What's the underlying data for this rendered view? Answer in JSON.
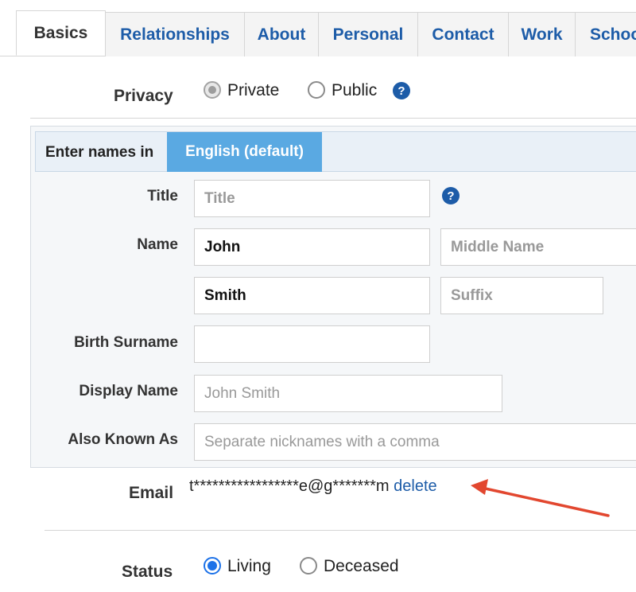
{
  "tabs": [
    {
      "label": "Basics",
      "active": true
    },
    {
      "label": "Relationships"
    },
    {
      "label": "About"
    },
    {
      "label": "Personal"
    },
    {
      "label": "Contact"
    },
    {
      "label": "Work"
    },
    {
      "label": "Schoo"
    }
  ],
  "privacy": {
    "label": "Privacy",
    "options": [
      {
        "label": "Private",
        "selected": true
      },
      {
        "label": "Public",
        "selected": false
      }
    ],
    "help_icon": "?"
  },
  "names": {
    "header_label": "Enter names in",
    "language": "English (default)",
    "fields": {
      "title": {
        "label": "Title",
        "value": "",
        "placeholder": "Title",
        "help_icon": "?"
      },
      "name": {
        "label": "Name",
        "first": "John",
        "middle_placeholder": "Middle Name",
        "last": "Smith",
        "suffix_placeholder": "Suffix"
      },
      "birth_surname": {
        "label": "Birth Surname",
        "value": ""
      },
      "display_name": {
        "label": "Display Name",
        "placeholder": "John Smith"
      },
      "also_known_as": {
        "label": "Also Known As",
        "placeholder": "Separate nicknames with a comma"
      }
    }
  },
  "email": {
    "label": "Email",
    "masked_value": "t*****************e@g*******m",
    "delete_label": "delete"
  },
  "status": {
    "label": "Status",
    "options": [
      {
        "label": "Living",
        "selected": true
      },
      {
        "label": "Deceased",
        "selected": false
      }
    ]
  },
  "colors": {
    "link_blue": "#1d5ca8",
    "language_button": "#5aa9e2",
    "annotation_arrow": "#e2472f",
    "radio_selected_blue": "#1d72e8"
  }
}
